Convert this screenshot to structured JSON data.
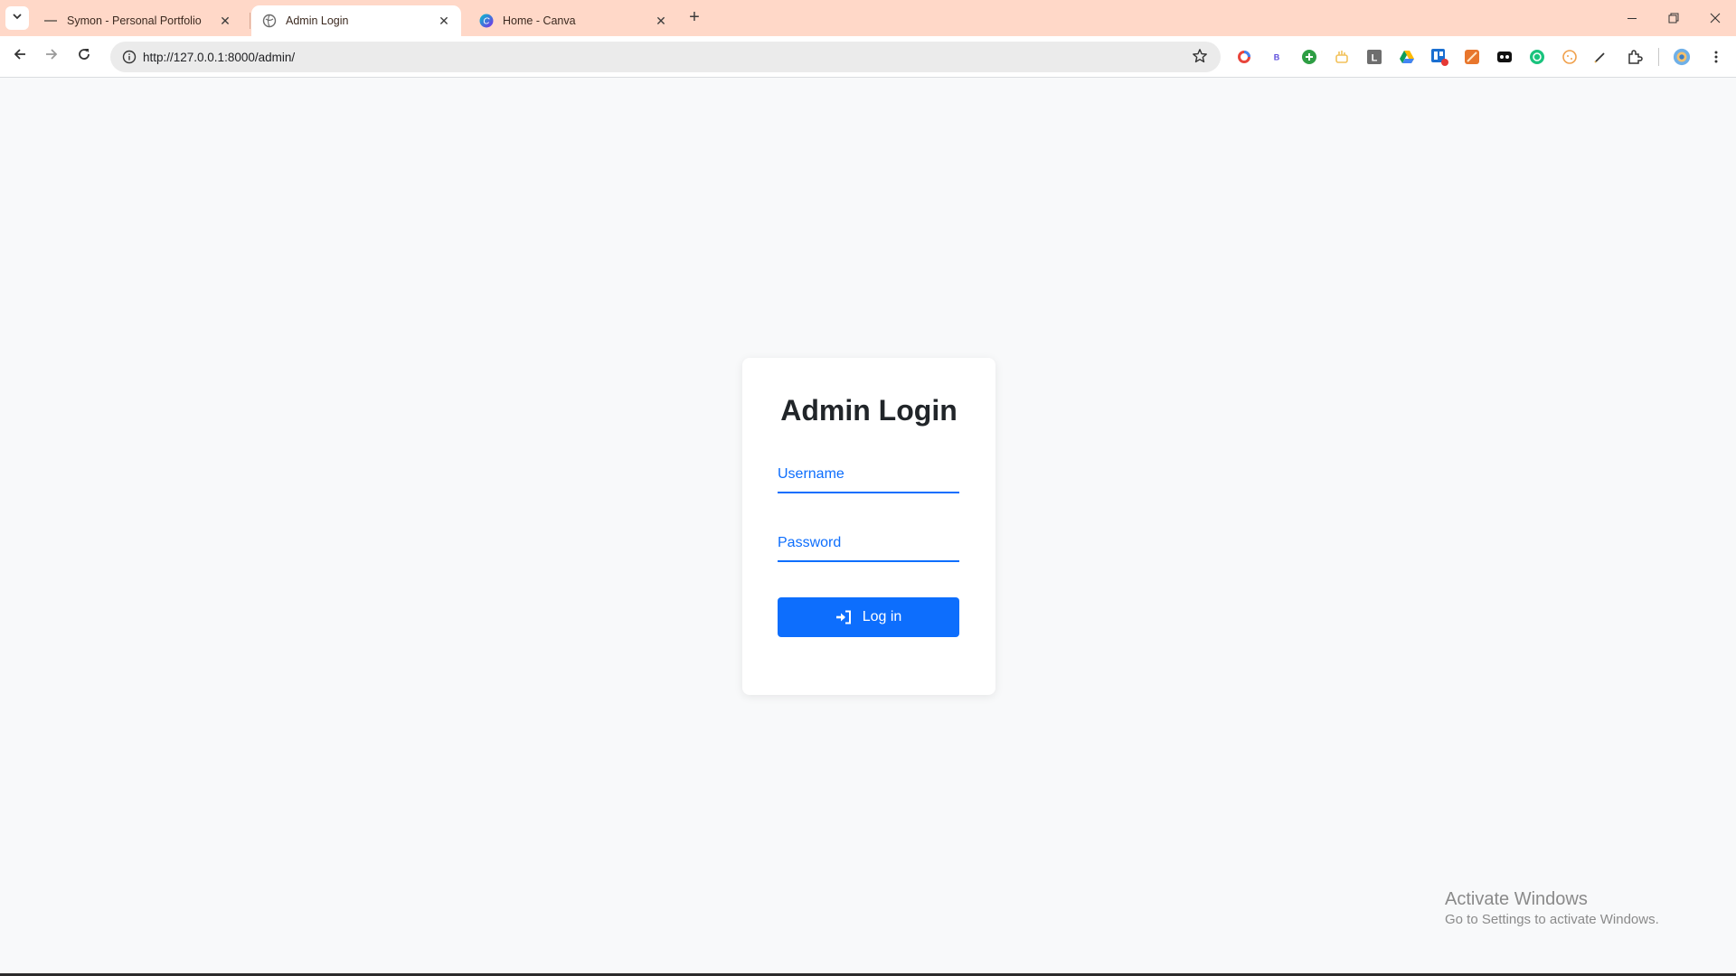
{
  "browser": {
    "tabs": [
      {
        "title": "Symon - Personal Portfolio",
        "active": false
      },
      {
        "title": "Admin Login",
        "active": true
      },
      {
        "title": "Home - Canva",
        "active": false
      }
    ],
    "url": "http://127.0.0.1:8000/admin/",
    "accent_color": "#ffd8c8"
  },
  "login": {
    "title": "Admin Login",
    "username_placeholder": "Username",
    "password_placeholder": "Password",
    "button_label": "Log in",
    "button_icon": "sign-in-icon",
    "primary_color": "#0d6efd"
  },
  "watermark": {
    "line1": "Activate Windows",
    "line2": "Go to Settings to activate Windows."
  }
}
